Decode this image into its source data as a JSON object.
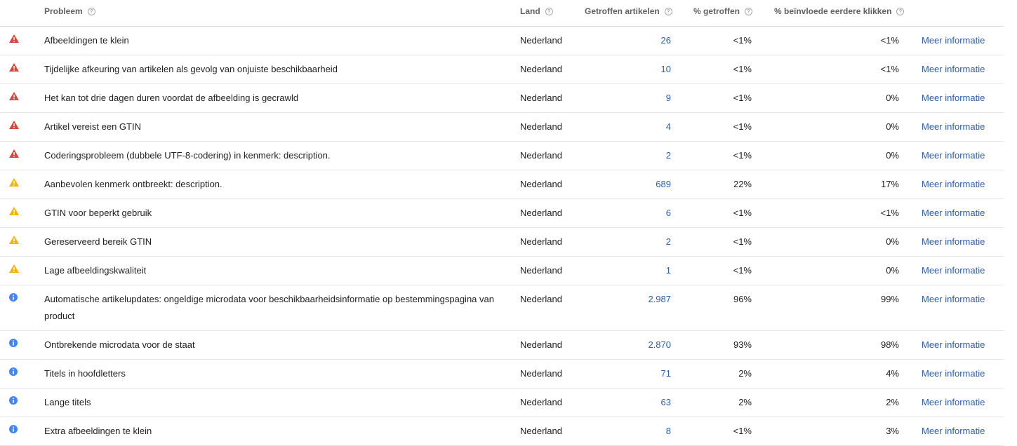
{
  "header": {
    "issue": "Probleem",
    "country": "Land",
    "affected": "Getroffen artikelen",
    "pct_affected": "% getroffen",
    "pct_clicks": "% beïnvloede eerdere klikken",
    "help_glyph": "?"
  },
  "colors": {
    "error": "#db4437",
    "warning": "#f4b400",
    "info": "#4285f4",
    "link": "#2a5db0"
  },
  "rows": [
    {
      "severity": "error",
      "icon": "error-icon",
      "issue": "Afbeeldingen te klein",
      "country": "Nederland",
      "affected": "26",
      "pct": "<1%",
      "clicks": "<1%",
      "link": "Meer informatie"
    },
    {
      "severity": "error",
      "icon": "error-icon",
      "issue": "Tijdelijke afkeuring van artikelen als gevolg van onjuiste beschikbaarheid",
      "country": "Nederland",
      "affected": "10",
      "pct": "<1%",
      "clicks": "<1%",
      "link": "Meer informatie"
    },
    {
      "severity": "error",
      "icon": "error-icon",
      "issue": "Het kan tot drie dagen duren voordat de afbeelding is gecrawld",
      "country": "Nederland",
      "affected": "9",
      "pct": "<1%",
      "clicks": "0%",
      "link": "Meer informatie"
    },
    {
      "severity": "error",
      "icon": "error-icon",
      "issue": "Artikel vereist een GTIN",
      "country": "Nederland",
      "affected": "4",
      "pct": "<1%",
      "clicks": "0%",
      "link": "Meer informatie"
    },
    {
      "severity": "error",
      "icon": "error-icon",
      "issue": "Coderingsprobleem (dubbele UTF-8-codering) in kenmerk: description.",
      "country": "Nederland",
      "affected": "2",
      "pct": "<1%",
      "clicks": "0%",
      "link": "Meer informatie"
    },
    {
      "severity": "warning",
      "icon": "warning-icon",
      "issue": "Aanbevolen kenmerk ontbreekt: description.",
      "country": "Nederland",
      "affected": "689",
      "pct": "22%",
      "clicks": "17%",
      "link": "Meer informatie"
    },
    {
      "severity": "warning",
      "icon": "warning-icon",
      "issue": "GTIN voor beperkt gebruik",
      "country": "Nederland",
      "affected": "6",
      "pct": "<1%",
      "clicks": "<1%",
      "link": "Meer informatie"
    },
    {
      "severity": "warning",
      "icon": "warning-icon",
      "issue": "Gereserveerd bereik GTIN",
      "country": "Nederland",
      "affected": "2",
      "pct": "<1%",
      "clicks": "0%",
      "link": "Meer informatie"
    },
    {
      "severity": "warning",
      "icon": "warning-icon",
      "issue": "Lage afbeeldingskwaliteit",
      "country": "Nederland",
      "affected": "1",
      "pct": "<1%",
      "clicks": "0%",
      "link": "Meer informatie"
    },
    {
      "severity": "info",
      "icon": "info-icon",
      "issue": "Automatische artikelupdates: ongeldige microdata voor beschikbaarheidsinformatie op bestemmingspagina van product",
      "country": "Nederland",
      "affected": "2.987",
      "pct": "96%",
      "clicks": "99%",
      "link": "Meer informatie"
    },
    {
      "severity": "info",
      "icon": "info-icon",
      "issue": "Ontbrekende microdata voor de staat",
      "country": "Nederland",
      "affected": "2.870",
      "pct": "93%",
      "clicks": "98%",
      "link": "Meer informatie"
    },
    {
      "severity": "info",
      "icon": "info-icon",
      "issue": "Titels in hoofdletters",
      "country": "Nederland",
      "affected": "71",
      "pct": "2%",
      "clicks": "4%",
      "link": "Meer informatie"
    },
    {
      "severity": "info",
      "icon": "info-icon",
      "issue": "Lange titels",
      "country": "Nederland",
      "affected": "63",
      "pct": "2%",
      "clicks": "2%",
      "link": "Meer informatie"
    },
    {
      "severity": "info",
      "icon": "info-icon",
      "issue": "Extra afbeeldingen te klein",
      "country": "Nederland",
      "affected": "8",
      "pct": "<1%",
      "clicks": "3%",
      "link": "Meer informatie"
    }
  ]
}
